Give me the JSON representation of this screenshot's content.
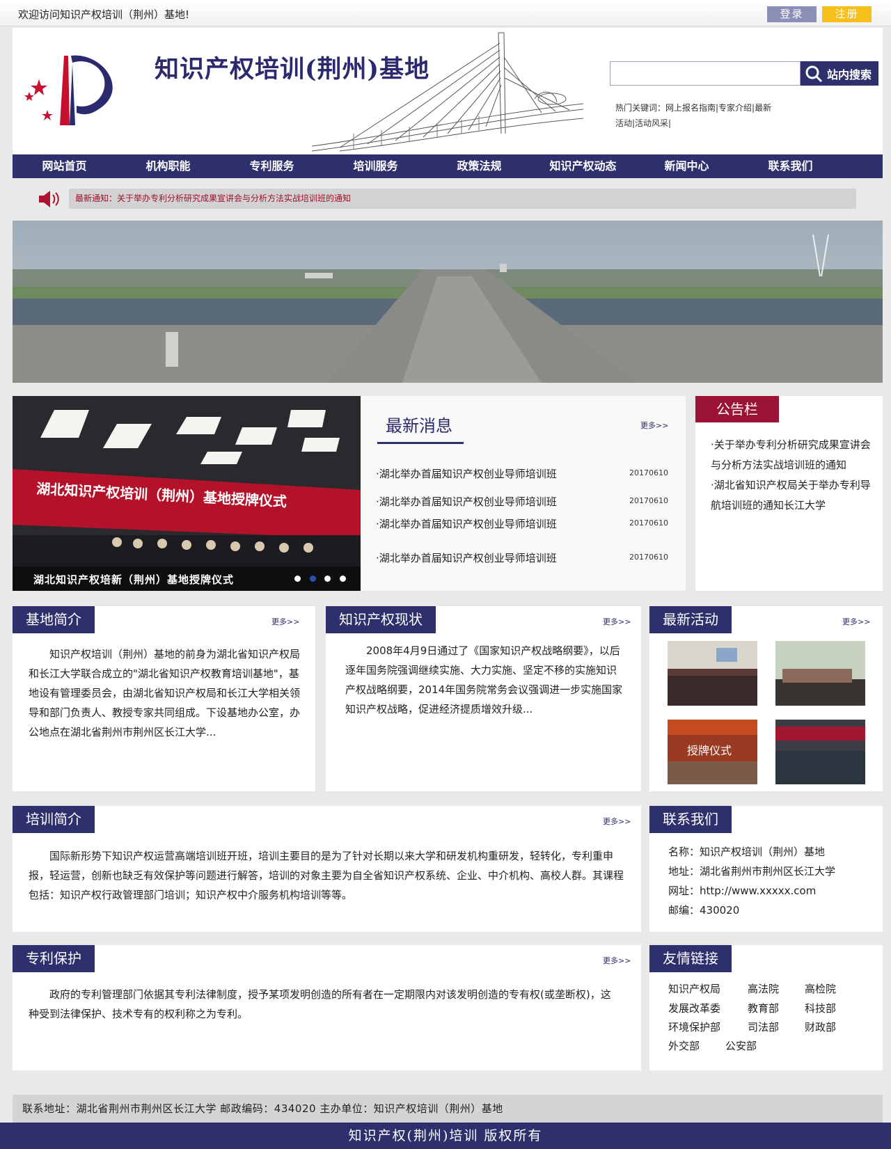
{
  "topbar": {
    "welcome": "欢迎访问知识产权培训（荆州）基地!",
    "login_label": "登录",
    "register_label": "注册"
  },
  "header": {
    "site_title": "知识产权培训(荆州)基地",
    "search_button": "站内搜索",
    "search_value": "",
    "hot_keywords": "热门关键词：网上报名指南|专家介绍|最新活动|活动风采|"
  },
  "nav": {
    "items": [
      "网站首页",
      "机构职能",
      "专利服务",
      "培训服务",
      "政策法规",
      "知识产权动态",
      "新闻中心",
      "联系我们"
    ]
  },
  "notice_bar": {
    "text": "最新通知：关于举办专利分析研究成果宣讲会与分析方法实战培训班的通知"
  },
  "slide": {
    "banner_text": "湖北知识产权培训（荆州）基地授牌仪式",
    "caption": "湖北知识产权培新（荆州）基地授牌仪式",
    "dots": 4,
    "active_dot": 2
  },
  "latest_news": {
    "title": "最新消息",
    "more": "更多>>",
    "items": [
      {
        "title": "·湖北举办首届知识产权创业导师培训班",
        "date": "20170610"
      },
      {
        "title": "·湖北举办首届知识产权创业导师培训班",
        "date": "20170610"
      },
      {
        "title": "·湖北举办首届知识产权创业导师培训班",
        "date": "20170610"
      },
      {
        "title": "·湖北举办首届知识产权创业导师培训班",
        "date": "20170610"
      }
    ]
  },
  "bulletin": {
    "title": "公告栏",
    "items": [
      "·关于举办专利分析研究成果宣讲会与分析方法实战培训班的通知",
      "·湖北省知识产权局关于举办专利导航培训班的通知长江大学"
    ]
  },
  "intro": {
    "title": "基地简介",
    "more": "更多>>",
    "text": "知识产权培训（荆州）基地的前身为湖北省知识产权局和长江大学联合成立的\"湖北省知识产权教育培训基地\"，基地设有管理委员会，由湖北省知识产权局和长江大学相关领导和部门负责人、教授专家共同组成。下设基地办公室，办公地点在湖北省荆州市荆州区长江大学..."
  },
  "status": {
    "title": "知识产权现状",
    "more": "更多>>",
    "text": "2008年4月9日通过了《国家知识产权战略纲要》，以后逐年国务院强调继续实施、大力实施、坚定不移的实施知识产权战略纲要，2014年国务院常务会议强调进一步实施国家知识产权战略，促进经济提质增效升级..."
  },
  "activities": {
    "title": "最新活动",
    "more": "更多>>",
    "thumb_caption": "授牌仪式"
  },
  "training": {
    "title": "培训简介",
    "more": "更多>>",
    "text": "国际新形势下知识产权运营高端培训班开班，培训主要目的是为了针对长期以来大学和研发机构重研发，轻转化，专利重申报，轻运营，创新也缺乏有效保护等问题进行解答，培训的对象主要为自全省知识产权系统、企业、中介机构、高校人群。其课程包括：知识产权行政管理部门培训；知识产权中介服务机构培训等等。"
  },
  "contact": {
    "title": "联系我们",
    "lines": [
      "名称：知识产权培训（荆州）基地",
      "地址：湖北省荆州市荆州区长江大学",
      "网址：http://www.xxxxx.com",
      "邮编：430020"
    ]
  },
  "patent": {
    "title": "专利保护",
    "more": "更多>>",
    "text": "政府的专利管理部门依据其专利法律制度，授予某项发明创造的所有者在一定期限内对该发明创造的专有权(或垄断权)，这种受到法律保护、技术专有的权利称之为专利。"
  },
  "links": {
    "title": "友情链接",
    "items": [
      "知识产权局",
      "高法院",
      "高检院",
      "发展改革委",
      "教育部",
      "科技部",
      "环境保护部",
      "司法部",
      "财政部",
      "外交部",
      "公安部"
    ]
  },
  "footer": {
    "info": "联系地址：湖北省荆州市荆州区长江大学 邮政编码：434020 主办单位：知识产权培训（荆州）基地",
    "copyright": "知识产权(荆州)培训 版权所有"
  },
  "colors": {
    "brand_navy": "#2e2f6d",
    "bulletin_red": "#9c1235",
    "login_blue": "#8b8fb8",
    "register_yellow": "#f6bf1a"
  }
}
